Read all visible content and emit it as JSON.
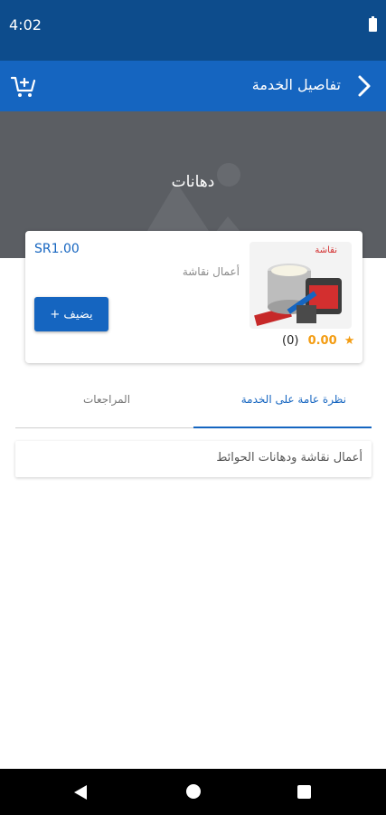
{
  "status_bar": {
    "time": "4:02"
  },
  "header": {
    "title": "تفاصيل الخدمة",
    "back_icon": "chevron-right-icon",
    "cart_icon": "cart-add-icon"
  },
  "banner": {
    "title": "دهانات"
  },
  "service": {
    "price": "SR1.00",
    "description": "أعمال نقاشة",
    "add_label": "يضيف +",
    "image_label": "نقاشة",
    "rating": "0.00",
    "rating_count": "(0)"
  },
  "tabs": [
    {
      "label": "نظرة عامة على الخدمة",
      "active": true
    },
    {
      "label": "المراجعات",
      "active": false
    }
  ],
  "overview": {
    "text": "أعمال نقاشة ودهانات الحوائط"
  },
  "colors": {
    "primary": "#1565c0",
    "status_bar": "#0d4c8c",
    "banner": "#5b5e63",
    "star": "#f39c12"
  }
}
